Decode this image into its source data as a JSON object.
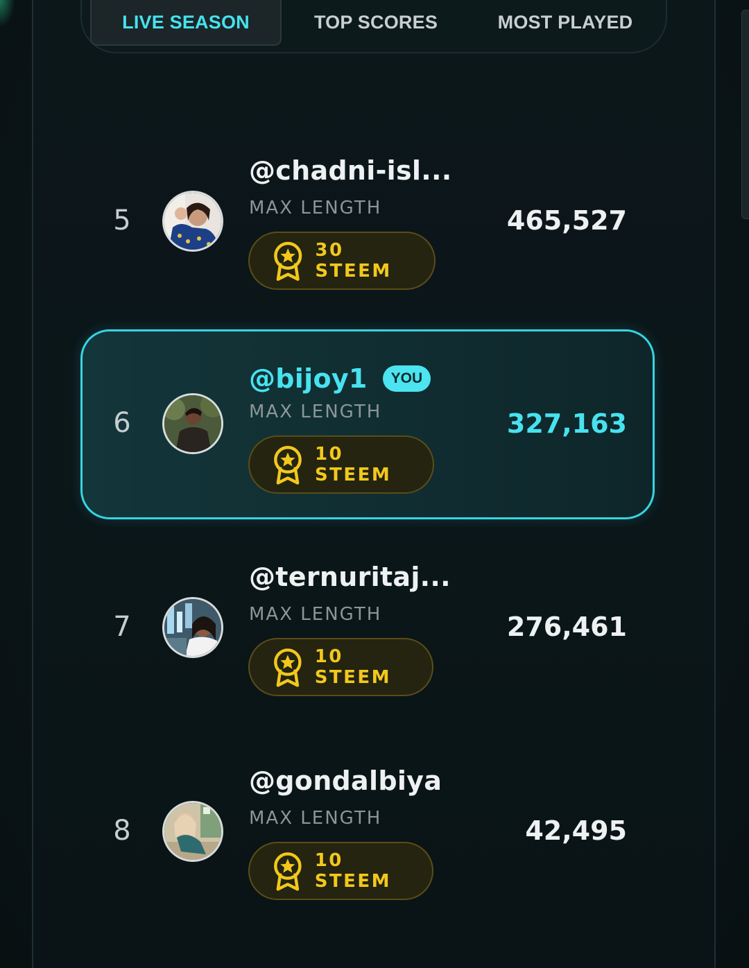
{
  "tabs": {
    "live_season": "LIVE SEASON",
    "top_scores": "TOP SCORES",
    "most_played": "MOST PLAYED",
    "active": "live_season"
  },
  "colors": {
    "accent": "#45e3ef",
    "gold": "#f2c81c",
    "background": "#0b1518"
  },
  "leaderboard": [
    {
      "rank": "5",
      "username": "@chadni-isl...",
      "metric": "MAX LENGTH",
      "prize": "30 STEEM",
      "score": "465,527",
      "is_you": false
    },
    {
      "rank": "6",
      "username": "@bijoy1",
      "badge": "YOU",
      "metric": "MAX LENGTH",
      "prize": "10 STEEM",
      "score": "327,163",
      "is_you": true
    },
    {
      "rank": "7",
      "username": "@ternuritaj...",
      "metric": "MAX LENGTH",
      "prize": "10 STEEM",
      "score": "276,461",
      "is_you": false
    },
    {
      "rank": "8",
      "username": "@gondalbiya",
      "metric": "MAX LENGTH",
      "prize": "10 STEEM",
      "score": "42,495",
      "is_you": false
    }
  ],
  "icons": {
    "prize": "award-ribbon-star-icon",
    "avatar": "user-avatar"
  }
}
